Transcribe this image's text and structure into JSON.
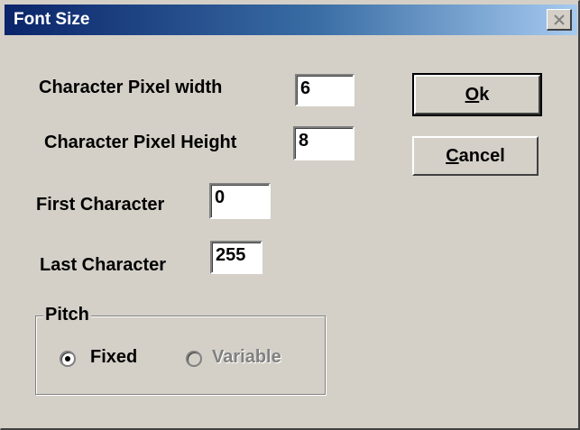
{
  "window": {
    "title": "Font Size",
    "close_icon": "close-icon"
  },
  "fields": {
    "char_width": {
      "label": "Character Pixel width",
      "value": "6"
    },
    "char_height": {
      "label": "Character Pixel Height",
      "value": "8"
    },
    "first_char": {
      "label": "First Character",
      "value": "0"
    },
    "last_char": {
      "label": "Last Character",
      "value": "255"
    }
  },
  "buttons": {
    "ok": {
      "mnemonic": "O",
      "rest": "k"
    },
    "cancel": {
      "mnemonic": "C",
      "rest": "ancel"
    }
  },
  "pitch": {
    "legend": "Pitch",
    "options": [
      {
        "label": "Fixed",
        "selected": true,
        "enabled": true
      },
      {
        "label": "Variable",
        "selected": false,
        "enabled": false
      }
    ]
  }
}
